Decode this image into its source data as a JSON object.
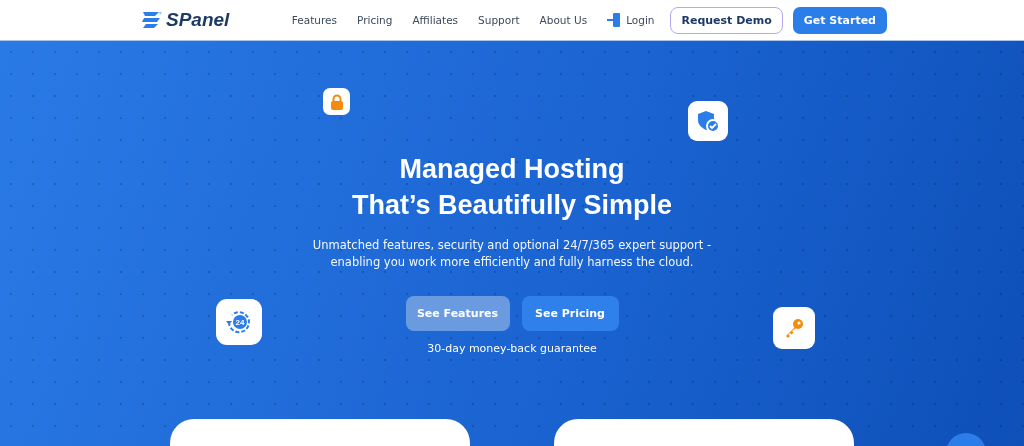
{
  "header": {
    "logo": "SPanel",
    "nav": [
      "Features",
      "Pricing",
      "Affiliates",
      "Support",
      "About Us"
    ],
    "login": "Login",
    "request_demo": "Request Demo",
    "get_started": "Get Started"
  },
  "hero": {
    "title_lines": [
      "Managed Hosting",
      "That’s Beautifully Simple"
    ],
    "subtitle_lines": [
      "Unmatched features, security and optional 24/7/365 expert support -",
      "enabling you work more efficiently and fully harness the cloud."
    ],
    "buttons": [
      "See Features",
      "See Pricing"
    ],
    "guarantee": "30-day money-back guarantee",
    "support_badge": "24"
  }
}
